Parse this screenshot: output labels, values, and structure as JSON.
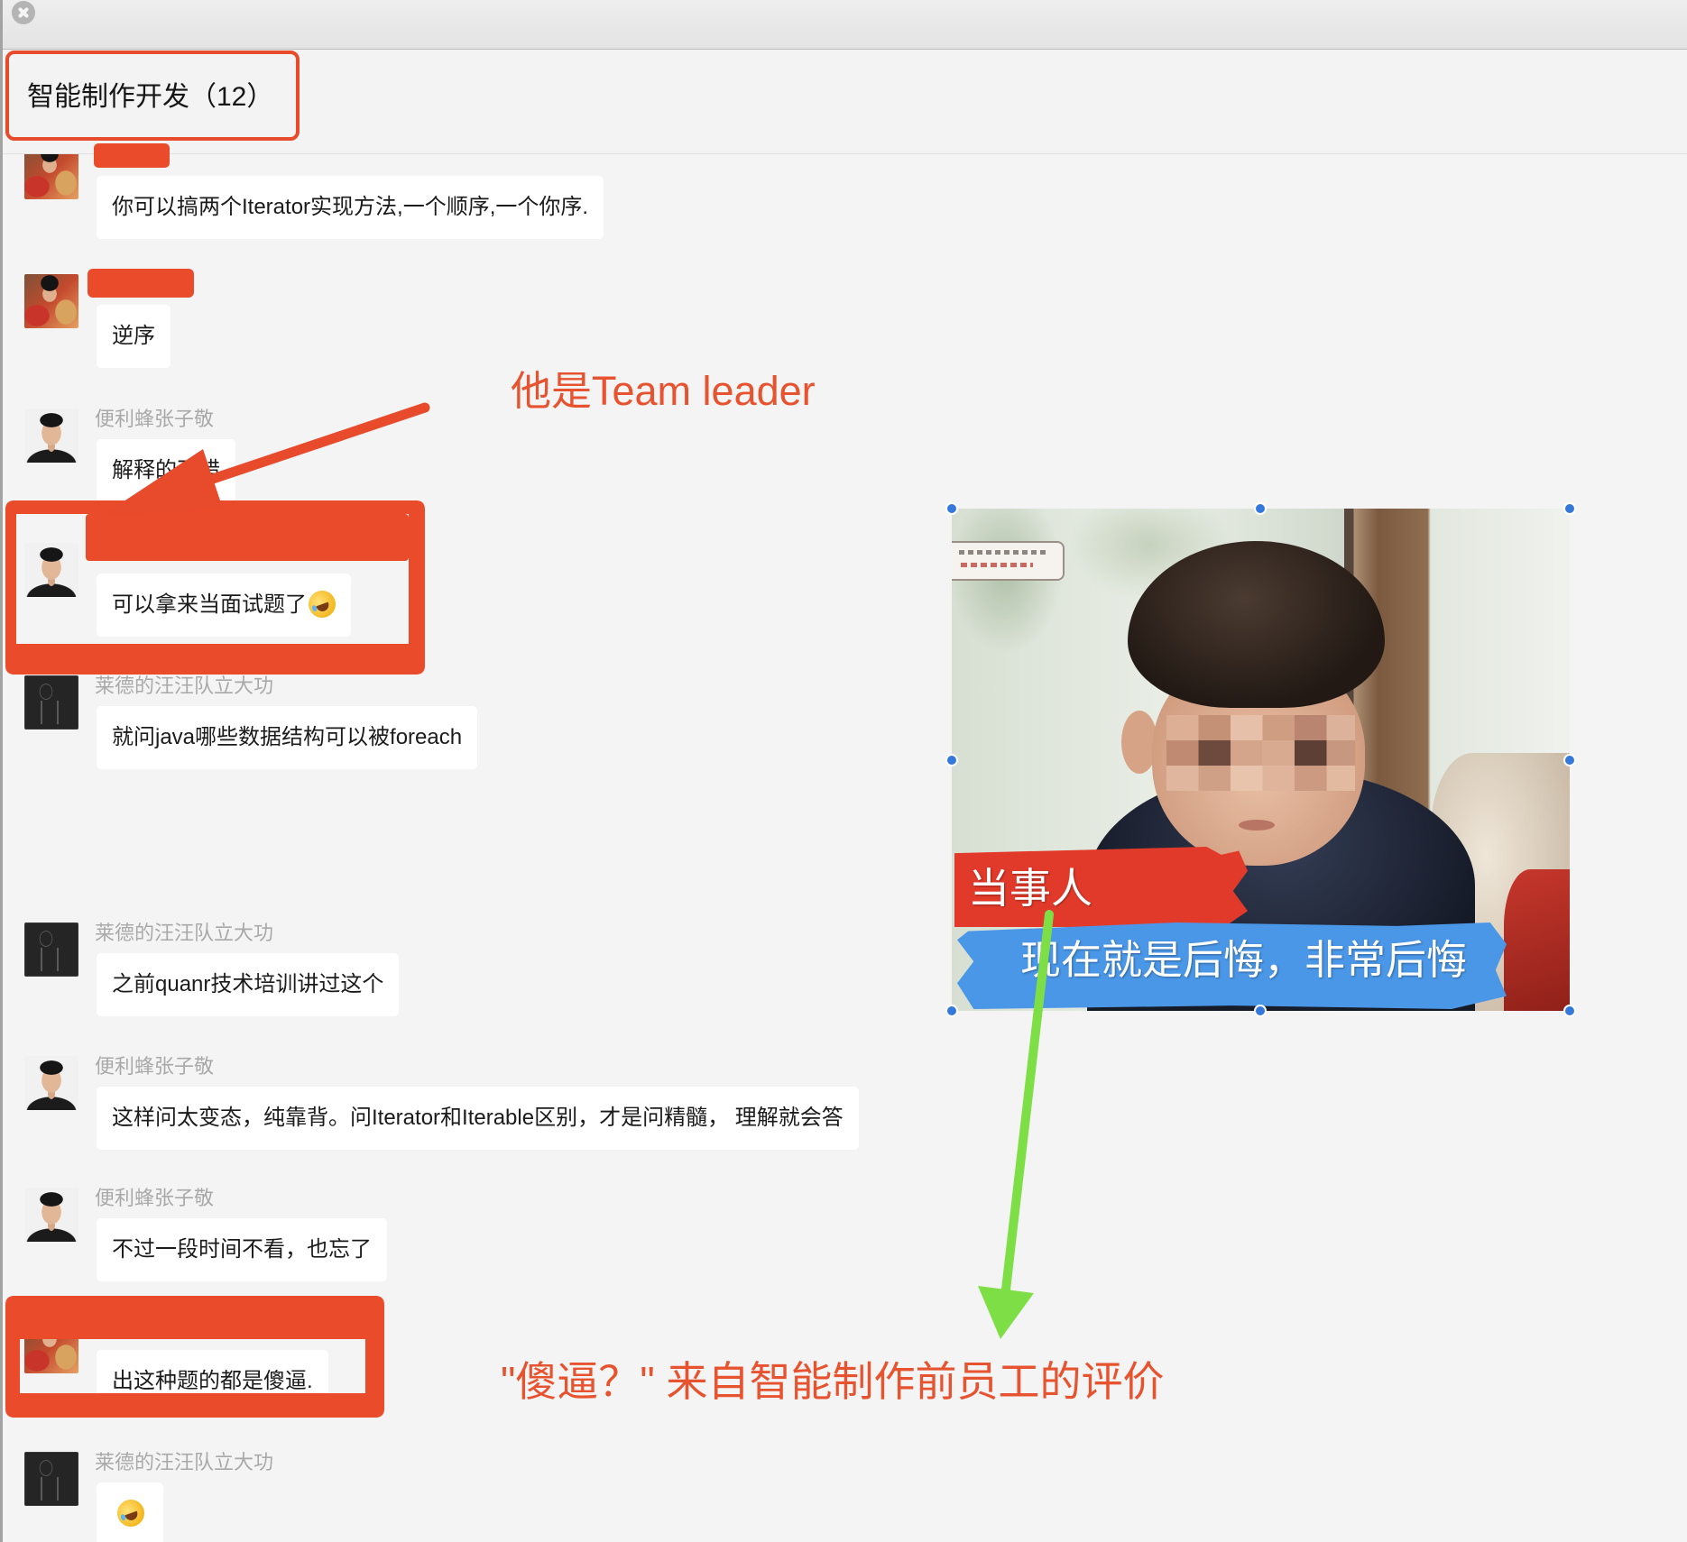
{
  "chat": {
    "title": "智能制作开发（12）"
  },
  "messages": [
    {
      "avatar": "colorful-avatar",
      "text": "你可以搞两个Iterator实现方法,一个顺序,一个你序."
    },
    {
      "avatar": "colorful-avatar",
      "text": "逆序"
    },
    {
      "avatar": "person-photo-avatar",
      "sender": "便利蜂张子敬",
      "text": "解释的不错"
    },
    {
      "avatar": "person-photo-avatar",
      "text": "可以拿来当面试题了",
      "emoji": "laughing-emoji-icon"
    },
    {
      "avatar": "dark-avatar",
      "sender": "莱德的汪汪队立大功",
      "text": "就问java哪些数据结构可以被foreach"
    },
    {
      "avatar": "dark-avatar",
      "sender": "莱德的汪汪队立大功",
      "text": "之前quanr技术培训讲过这个"
    },
    {
      "avatar": "person-photo-avatar",
      "sender": "便利蜂张子敬",
      "text": "这样问太变态，纯靠背。问Iterator和Iterable区别，才是问精髓， 理解就会答"
    },
    {
      "avatar": "person-photo-avatar",
      "sender": "便利蜂张子敬",
      "text": "不过一段时间不看，也忘了"
    },
    {
      "avatar": "colorful-avatar",
      "text": "出这种题的都是傻逼."
    },
    {
      "avatar": "dark-avatar",
      "sender": "莱德的汪汪队立大功",
      "emoji": "laughing-emoji-icon"
    }
  ],
  "annotations": {
    "team_leader_note": "他是Team leader",
    "evaluation_note": "\"傻逼？\" 来自智能制作前员工的评价"
  },
  "meme": {
    "caption_label": "当事人",
    "caption_text": "现在就是后悔，非常后悔"
  },
  "icons": {
    "close": "close-icon"
  },
  "colors": {
    "annotation_red": "#e84a2c",
    "arrow_green": "#7ddf45",
    "selection_handle_blue": "#3478dc",
    "bubble": "#ffffff",
    "background": "#f4f4f4"
  }
}
